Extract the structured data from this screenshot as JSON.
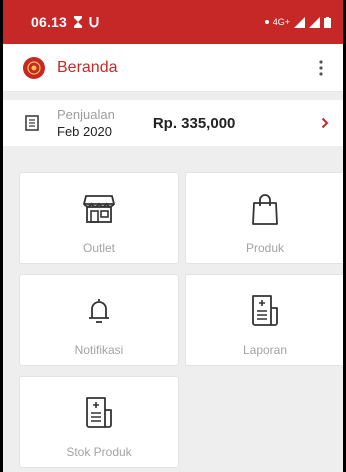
{
  "status_bar": {
    "time": "06.13",
    "network": "4G+"
  },
  "app_bar": {
    "title": "Beranda"
  },
  "sales_summary": {
    "label": "Penjualan",
    "period": "Feb 2020",
    "amount": "Rp. 335,000"
  },
  "menu": [
    {
      "label": "Outlet",
      "icon": "storefront-icon"
    },
    {
      "label": "Produk",
      "icon": "shopping-bag-icon"
    },
    {
      "label": "Notifikasi",
      "icon": "bell-icon"
    },
    {
      "label": "Laporan",
      "icon": "report-icon"
    },
    {
      "label": "Stok Produk",
      "icon": "report-icon"
    }
  ],
  "colors": {
    "primary": "#c62828",
    "background": "#eeeeee",
    "muted_text": "#a3a3a3"
  }
}
